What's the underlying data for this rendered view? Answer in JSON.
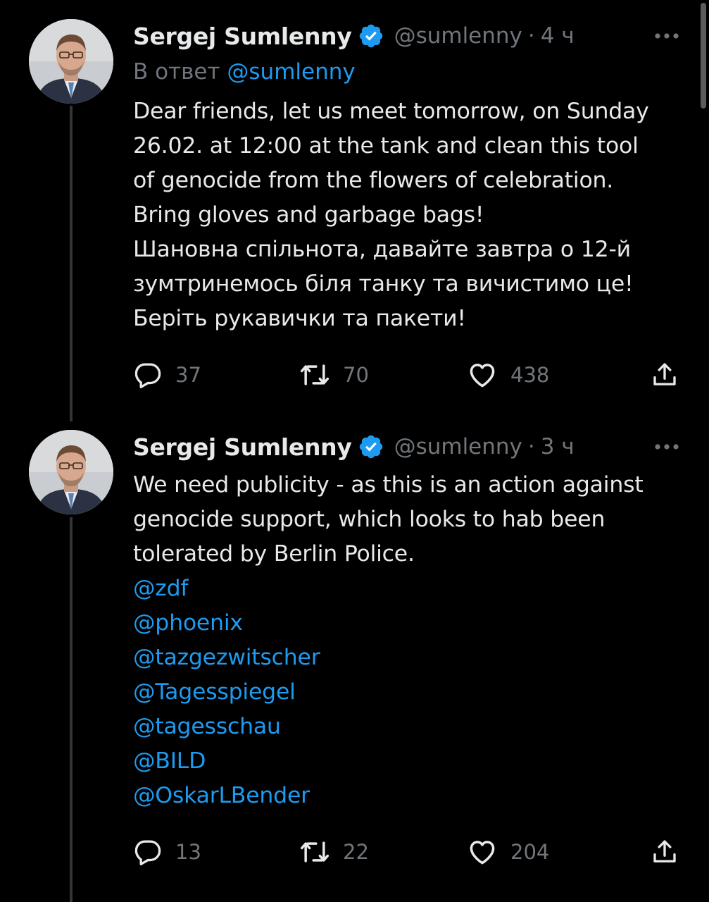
{
  "tweets": [
    {
      "author": {
        "name": "Sergej Sumlenny",
        "handle": "@sumlenny",
        "separator": "·"
      },
      "time": "4 ч",
      "reply_prefix": "В ответ",
      "reply_to": "@sumlenny",
      "text_lines": [
        "Dear friends, let us meet tomorrow, on Sunday",
        "26.02. at 12:00 at the tank and clean this tool",
        "of genocide from the flowers of celebration.",
        "Bring gloves and garbage bags!",
        "Шановна спільнота, давайте завтра о 12-й",
        "зумтринемось біля танку та вичистимо це!",
        "Беріть рукавички та пакети!"
      ],
      "stats": {
        "replies": "37",
        "retweets": "70",
        "likes": "438"
      }
    },
    {
      "author": {
        "name": "Sergej Sumlenny",
        "handle": "@sumlenny",
        "separator": "·"
      },
      "time": "3 ч",
      "text_lines": [
        "We need publicity - as this is an action against",
        "genocide support, which looks to hab been",
        "tolerated by Berlin Police."
      ],
      "mentions": [
        "@zdf",
        "@phoenix",
        "@tazgezwitscher",
        "@Tagesspiegel",
        "@tagesschau",
        "@BILD",
        "@OskarLBender"
      ],
      "stats": {
        "replies": "13",
        "retweets": "22",
        "likes": "204"
      }
    }
  ],
  "icons": {
    "verified": "verified-badge-icon",
    "more": "more-options-icon",
    "reply": "reply-icon",
    "retweet": "retweet-icon",
    "like": "like-icon",
    "share": "share-icon"
  },
  "colors": {
    "background": "#000000",
    "text": "#e7e9ea",
    "muted": "#71767b",
    "link": "#1d9bf0",
    "verified": "#1d9bf0",
    "thread_line": "#333639"
  }
}
